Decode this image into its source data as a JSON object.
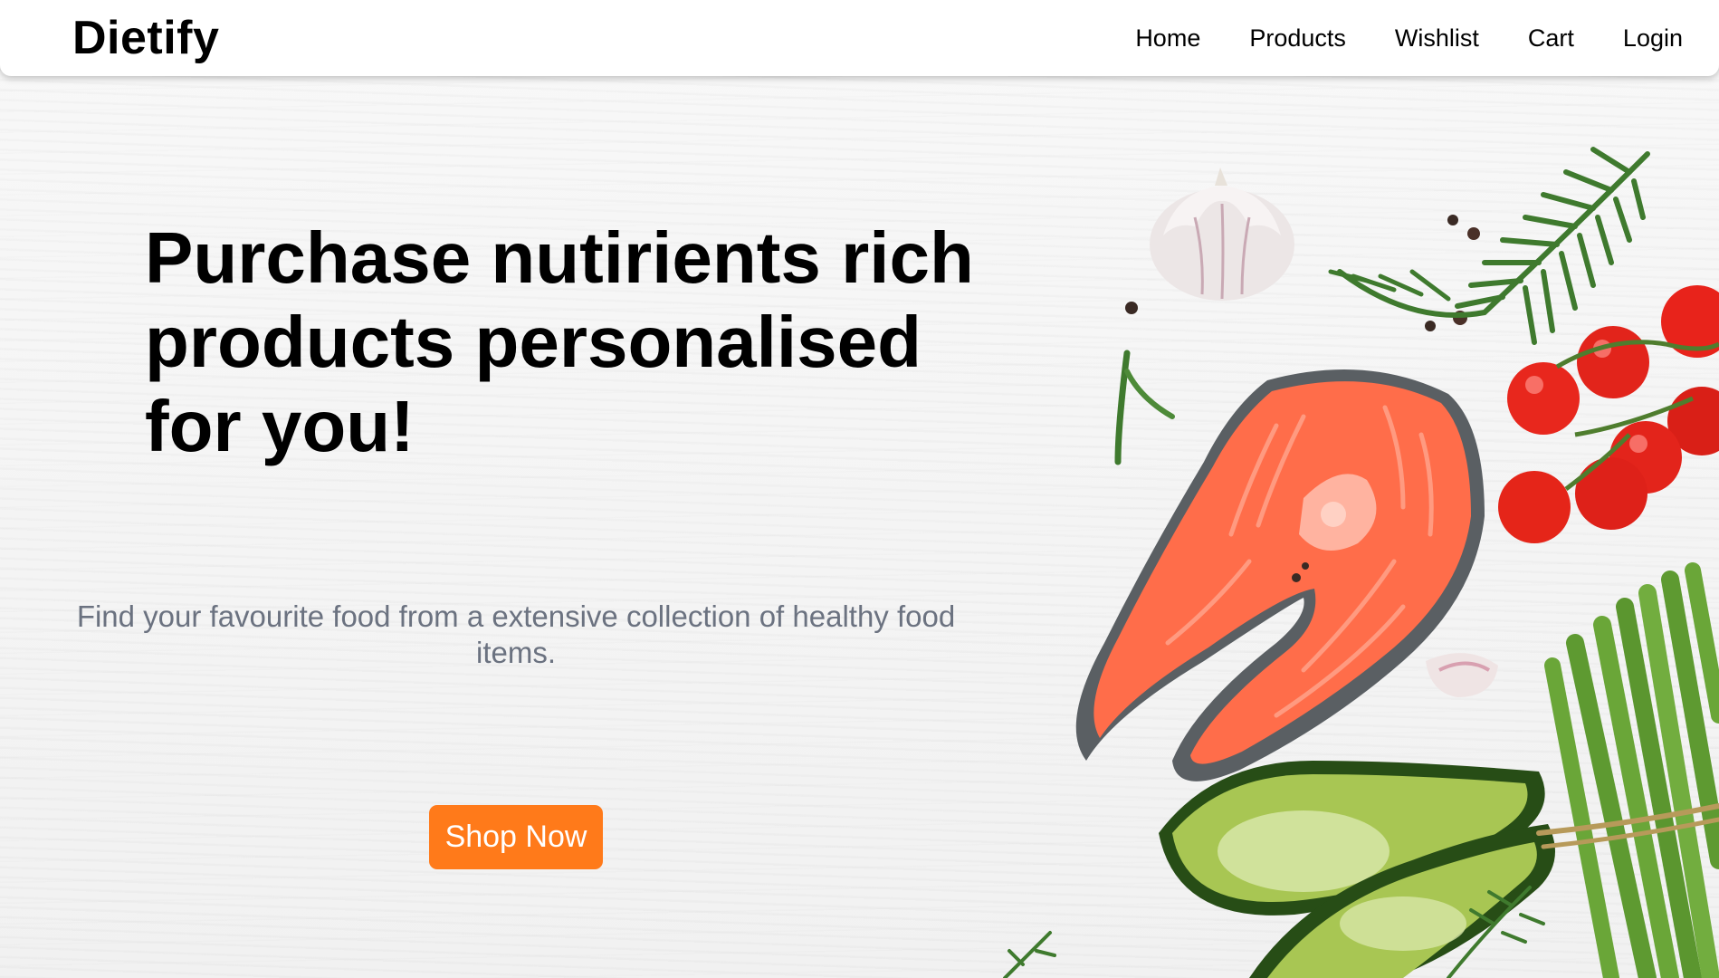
{
  "navbar": {
    "brand": "Dietify",
    "links": [
      "Home",
      "Products",
      "Wishlist",
      "Cart",
      "Login"
    ]
  },
  "hero": {
    "headline": "Purchase nutirients rich products personalised for you!",
    "subtitle": "Find your favourite food from a extensive collection of healthy food items.",
    "cta_label": "Shop Now"
  },
  "colors": {
    "accent": "#ff7a1a",
    "subtitle": "#6b7280",
    "text": "#000000",
    "navbar_bg": "#ffffff"
  }
}
